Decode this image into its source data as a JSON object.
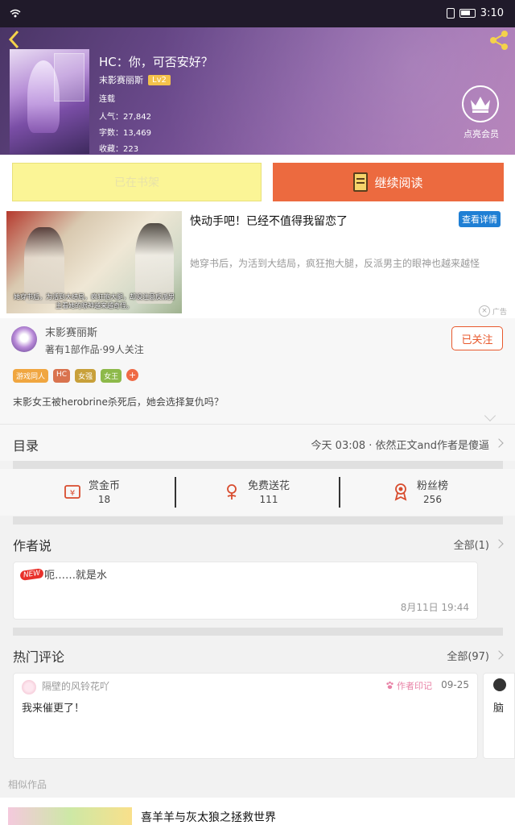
{
  "status_bar": {
    "time": "3:10"
  },
  "book": {
    "title": "HC：你，可否安好？",
    "author": "末影赛丽斯",
    "level": "Lv2",
    "status": "连载",
    "popularity": "人气：27,842",
    "word_count": "字数：13,469",
    "favorites": "收藏：223",
    "vip_label": "点亮会员"
  },
  "actions": {
    "shelf": "已在书架",
    "read": "继续阅读"
  },
  "ad": {
    "title": "快动手吧！已经不值得我留恋了",
    "detail_btn": "查看详情",
    "desc": "她穿书后，为活到大结局，疯狂抱大腿，反派男主的眼神也越来越怪",
    "image_caption": "她穿书后，为活到大结局，疯狂抱大腿，却没注意反派男主看她的眼神越来越奇怪。",
    "mark": "广告"
  },
  "author_info": {
    "name": "末影赛丽斯",
    "meta": "著有1部作品·99人关注",
    "follow": "已关注",
    "tags": [
      {
        "label": "游戏同人",
        "color": "#f0a640"
      },
      {
        "label": "HC",
        "color": "#d9734e"
      },
      {
        "label": "女强",
        "color": "#c8a03a"
      },
      {
        "label": "女王",
        "color": "#8db94a"
      }
    ],
    "tag_more": "+",
    "intro": "末影女王被herobrine杀死后，她会选择复仇吗？"
  },
  "catalog": {
    "title": "目录",
    "latest": "今天 03:08 · 依然正文and作者是傻逼"
  },
  "stats": [
    {
      "label": "赏金币",
      "value": "18",
      "icon": "coin-icon"
    },
    {
      "label": "免费送花",
      "value": "111",
      "icon": "flower-icon"
    },
    {
      "label": "粉丝榜",
      "value": "256",
      "icon": "medal-icon"
    }
  ],
  "author_says": {
    "title": "作者说",
    "all": "全部(1)",
    "badge": "NEW",
    "text": "呃……就是水",
    "time": "8月11日  19:44"
  },
  "hot_comments": {
    "title": "热门评论",
    "all": "全部(97)",
    "items": [
      {
        "user": "隔壁的风铃花吖",
        "badge": "作者印记",
        "date": "09-25",
        "text": "我来催更了！"
      },
      {
        "text": "脑"
      }
    ]
  },
  "similar": {
    "label": "相似作品",
    "items": [
      {
        "title": "喜羊羊与灰太狼之拯救世界"
      }
    ]
  }
}
